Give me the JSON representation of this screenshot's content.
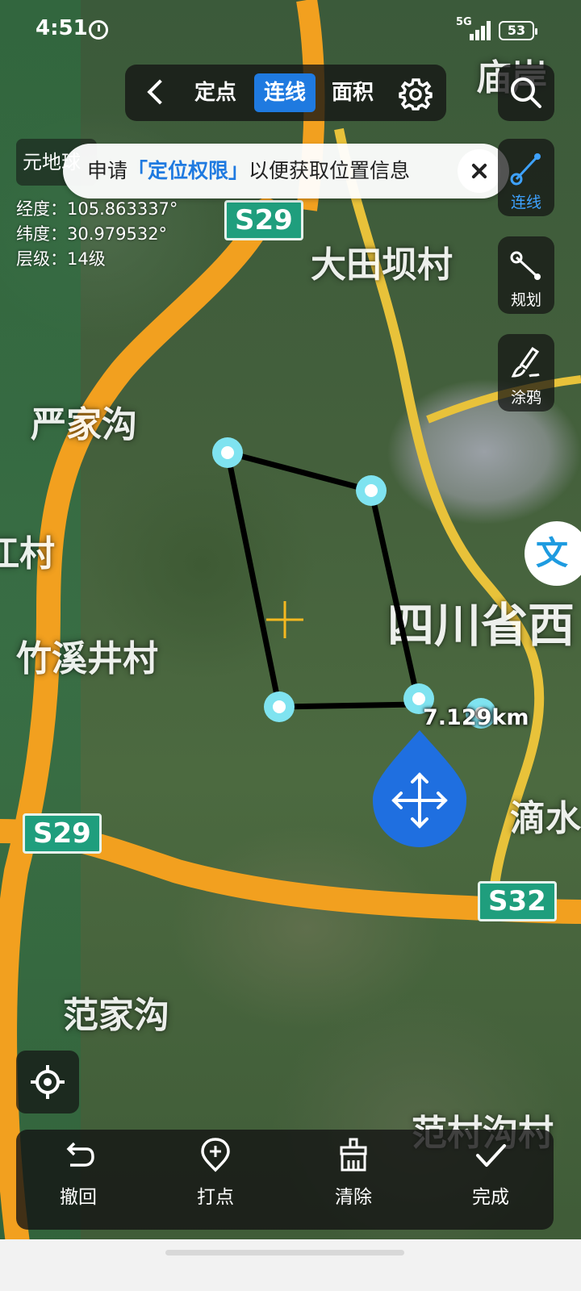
{
  "status_bar": {
    "time": "4:51",
    "network": "5G",
    "battery": "53"
  },
  "toolbar": {
    "tabs": [
      {
        "label": "定点",
        "active": false
      },
      {
        "label": "连线",
        "active": true
      },
      {
        "label": "面积",
        "active": false
      }
    ]
  },
  "toast": {
    "prefix": "申请",
    "highlight": "「定位权限」",
    "suffix": "以便获取位置信息"
  },
  "info": {
    "app_title": "元地球",
    "longitude": "经度：105.863337°",
    "latitude": "纬度：30.979532°",
    "level": "层级：14级"
  },
  "right_tools": [
    {
      "label": "连线",
      "icon": "polyline-icon",
      "active": true
    },
    {
      "label": "规划",
      "icon": "route-icon",
      "active": false
    },
    {
      "label": "涂鸦",
      "icon": "brush-icon",
      "active": false
    }
  ],
  "translate_icon_text": "文",
  "measurement": {
    "distance": "7.129km"
  },
  "map_labels": {
    "place_1": "大田坝村",
    "place_2": "严家沟",
    "place_3": "竹溪井村",
    "place_4": "范家沟",
    "place_5": "四川省西",
    "place_6": "江村",
    "place_7": "滴水",
    "place_8": "范村沟村",
    "place_9": "庙岸",
    "road_1": "S29",
    "road_2": "S29",
    "road_3": "S32"
  },
  "bottom_actions": [
    {
      "label": "撤回",
      "icon": "undo-icon"
    },
    {
      "label": "打点",
      "icon": "add-point-icon"
    },
    {
      "label": "清除",
      "icon": "broom-icon"
    },
    {
      "label": "完成",
      "icon": "check-icon"
    }
  ],
  "colors": {
    "accent": "#1f7ae0",
    "road": "#f5a623",
    "marker": "#7fe3f0"
  }
}
